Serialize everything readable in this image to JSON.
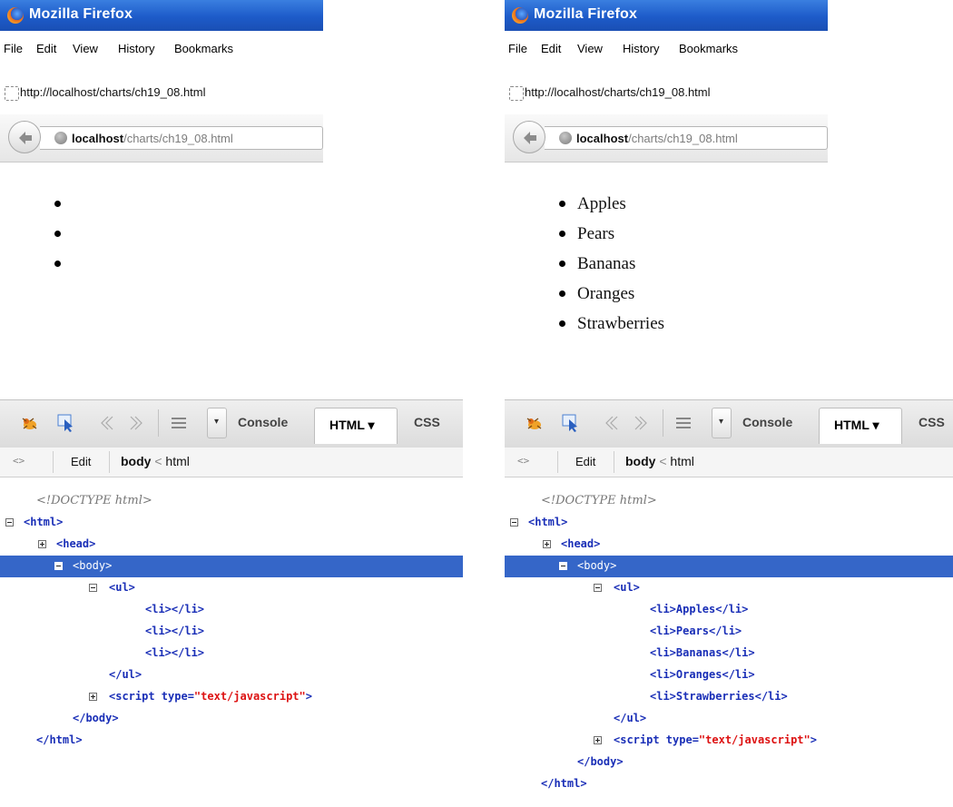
{
  "browser": {
    "title": "Mozilla Firefox",
    "menu": [
      "File",
      "Edit",
      "View",
      "History",
      "Bookmarks"
    ],
    "tab_url": "http://localhost/charts/ch19_08.html",
    "url_host": "localhost",
    "url_path": "/charts/ch19_08.html"
  },
  "firebug": {
    "tabs": {
      "console": "Console",
      "html": "HTML ▾",
      "css": "CSS"
    },
    "edit": "Edit",
    "breadcrumb": {
      "current": "body",
      "sep": "<",
      "parent": "html"
    }
  },
  "left": {
    "list_items": [
      "",
      "",
      ""
    ],
    "tree": {
      "doctype": "<!DOCTYPE html>",
      "html_open": "<html>",
      "head": "<head>",
      "body_open": "<body>",
      "ul_open": "<ul>",
      "li_items": [
        "<li></li>",
        "<li></li>",
        "<li></li>"
      ],
      "ul_close": "</ul>",
      "script_tag": "<script type=",
      "script_type": "\"text/javascript\"",
      "script_end": ">",
      "body_close": "</body>",
      "html_close": "</html>"
    }
  },
  "right": {
    "list_items": [
      "Apples",
      "Pears",
      "Bananas",
      "Oranges",
      "Strawberries"
    ],
    "tree": {
      "doctype": "<!DOCTYPE html>",
      "html_open": "<html>",
      "head": "<head>",
      "body_open": "<body>",
      "ul_open": "<ul>",
      "li_items": [
        "<li>Apples</li>",
        "<li>Pears</li>",
        "<li>Bananas</li>",
        "<li>Oranges</li>",
        "<li>Strawberries</li>"
      ],
      "ul_close": "</ul>",
      "script_tag": "<script type=",
      "script_type": "\"text/javascript\"",
      "script_end": ">",
      "body_close": "</body>",
      "html_close": "</html>"
    }
  }
}
